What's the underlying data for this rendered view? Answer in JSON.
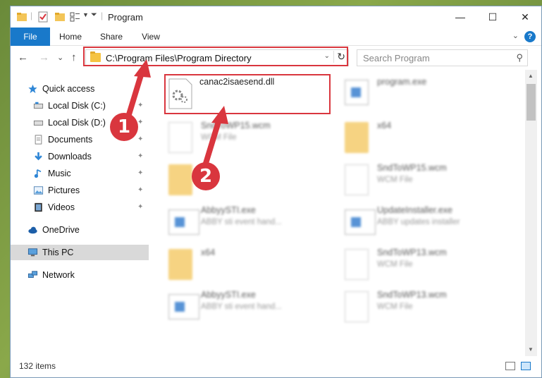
{
  "window": {
    "title": "Program",
    "minimize": "—",
    "maximize": "☐",
    "close": "✕"
  },
  "ribbon": {
    "tabs": [
      "File",
      "Home",
      "Share",
      "View"
    ],
    "help": "?",
    "chevron": "⌄"
  },
  "nav": {
    "back": "←",
    "forward": "→",
    "recent": "⌄",
    "up": "↑",
    "address": "C:\\Program Files\\Program Directory",
    "address_drop": "⌄",
    "refresh": "↻",
    "search_placeholder": "Search Program",
    "search_icon": "⚲"
  },
  "sidebar": {
    "items": [
      {
        "label": "Quick access",
        "icon": "star-icon"
      },
      {
        "label": "Local Disk (C:)",
        "icon": "drive-icon",
        "pinned": true
      },
      {
        "label": "Local Disk (D:)",
        "icon": "drive-icon",
        "pinned": true
      },
      {
        "label": "Documents",
        "icon": "documents-icon",
        "pinned": true
      },
      {
        "label": "Downloads",
        "icon": "download-icon",
        "pinned": true
      },
      {
        "label": "Music",
        "icon": "music-icon",
        "pinned": true
      },
      {
        "label": "Pictures",
        "icon": "pictures-icon",
        "pinned": true
      },
      {
        "label": "Videos",
        "icon": "videos-icon",
        "pinned": true
      },
      {
        "label": "OneDrive",
        "icon": "cloud-icon"
      },
      {
        "label": "This PC",
        "icon": "computer-icon",
        "selected": true
      },
      {
        "label": "Network",
        "icon": "network-icon"
      }
    ],
    "pin_glyph": "📌"
  },
  "files": {
    "highlighted": {
      "name": "canac2isaesend.dll"
    },
    "left": [
      {
        "name": "SndToWP15.wcm",
        "type": "WCM File",
        "kind": "doc"
      },
      {
        "name": "",
        "type": "",
        "kind": "folder"
      },
      {
        "name": "AbbyySTI.exe",
        "type": "ABBY sti event hand...",
        "kind": "exe"
      },
      {
        "name": "x64",
        "type": "",
        "kind": "folder"
      },
      {
        "name": "AbbyySTI.exe",
        "type": "ABBY sti event hand...",
        "kind": "exe"
      }
    ],
    "right": [
      {
        "name": "program.exe",
        "type": "",
        "kind": "exe"
      },
      {
        "name": "x64",
        "type": "",
        "kind": "folder"
      },
      {
        "name": "SndToWP15.wcm",
        "type": "WCM File",
        "kind": "doc"
      },
      {
        "name": "UpdateInstaller.exe",
        "type": "ABBY updates installer",
        "kind": "exe"
      },
      {
        "name": "SndToWP13.wcm",
        "type": "WCM File",
        "kind": "doc"
      },
      {
        "name": "SndToWP13.wcm",
        "type": "WCM File",
        "kind": "doc"
      }
    ]
  },
  "status": {
    "count": "132 items"
  },
  "callouts": [
    "1",
    "2"
  ],
  "colors": {
    "accent": "#1979ca",
    "highlight": "#d9363e",
    "folder": "#f3c558"
  }
}
